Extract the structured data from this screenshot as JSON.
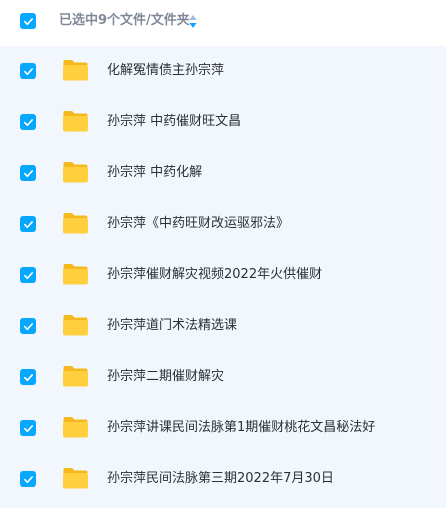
{
  "header": {
    "selection_text": "已选中9个文件/文件夹"
  },
  "colors": {
    "accent": "#06a7ff",
    "list_background": "#f2f7fe",
    "folder": "#ffcf3d"
  },
  "files": [
    {
      "name": "化解冤情债主孙宗萍",
      "checked": true,
      "icon": "folder-icon"
    },
    {
      "name": "孙宗萍 中药催财旺文昌",
      "checked": true,
      "icon": "folder-icon"
    },
    {
      "name": "孙宗萍 中药化解",
      "checked": true,
      "icon": "folder-icon"
    },
    {
      "name": "孙宗萍《中药旺财改运驱邪法》",
      "checked": true,
      "icon": "folder-icon"
    },
    {
      "name": "孙宗萍催财解灾视频2022年火供催财",
      "checked": true,
      "icon": "folder-icon"
    },
    {
      "name": "孙宗萍道门术法精选课",
      "checked": true,
      "icon": "folder-icon"
    },
    {
      "name": "孙宗萍二期催财解灾",
      "checked": true,
      "icon": "folder-icon"
    },
    {
      "name": "孙宗萍讲课民间法脉第1期催财桃花文昌秘法好",
      "checked": true,
      "icon": "folder-icon"
    },
    {
      "name": "孙宗萍民间法脉第三期2022年7月30日",
      "checked": true,
      "icon": "folder-icon"
    }
  ]
}
